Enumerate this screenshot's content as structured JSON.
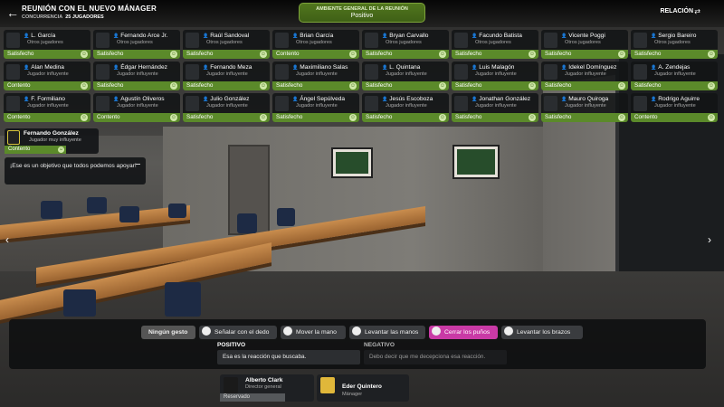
{
  "header": {
    "title": "REUNIÓN CON EL NUEVO MÁNAGER",
    "attendance_label": "CONCURRENCIA",
    "attendance_value": "25 JUGADORES",
    "mood_label": "AMBIENTE GENERAL DE LA REUNIÓN",
    "mood_value": "Positivo",
    "relation_label": "RELACIÓN"
  },
  "players": [
    {
      "name": "L. García",
      "role": "Otros jugadores",
      "status": "Satisfecho"
    },
    {
      "name": "Fernando Arce Jr.",
      "role": "Otros jugadores",
      "status": "Satisfecho"
    },
    {
      "name": "Raúl Sandoval",
      "role": "Otros jugadores",
      "status": "Satisfecho"
    },
    {
      "name": "Brian García",
      "role": "Otros jugadores",
      "status": "Contento"
    },
    {
      "name": "Bryan Carvallo",
      "role": "Otros jugadores",
      "status": "Satisfecho"
    },
    {
      "name": "Facundo Batista",
      "role": "Otros jugadores",
      "status": "Satisfecho"
    },
    {
      "name": "Vicente Poggi",
      "role": "Otros jugadores",
      "status": "Satisfecho"
    },
    {
      "name": "Sergio Bareiro",
      "role": "Otros jugadores",
      "status": "Satisfecho"
    },
    {
      "name": "Alan Medina",
      "role": "Jugador influyente",
      "status": "Contento"
    },
    {
      "name": "Édgar Hernández",
      "role": "Jugador influyente",
      "status": "Satisfecho"
    },
    {
      "name": "Fernando Meza",
      "role": "Jugador influyente",
      "status": "Satisfecho"
    },
    {
      "name": "Maximiliano Salas",
      "role": "Jugador influyente",
      "status": "Satisfecho"
    },
    {
      "name": "L. Quintana",
      "role": "Jugador influyente",
      "status": "Satisfecho"
    },
    {
      "name": "Luis Malagón",
      "role": "Jugador influyente",
      "status": "Satisfecho"
    },
    {
      "name": "Idekel Domínguez",
      "role": "Jugador influyente",
      "status": "Satisfecho"
    },
    {
      "name": "A. Zendejas",
      "role": "Jugador influyente",
      "status": "Satisfecho"
    },
    {
      "name": "F. Formiliano",
      "role": "Jugador influyente",
      "status": "Contento"
    },
    {
      "name": "Agustín Oliveros",
      "role": "Jugador influyente",
      "status": "Contento"
    },
    {
      "name": "Julio González",
      "role": "Jugador influyente",
      "status": "Satisfecho"
    },
    {
      "name": "Ángel Sepúlveda",
      "role": "Jugador influyente",
      "status": "Satisfecho"
    },
    {
      "name": "Jesús Escoboza",
      "role": "Jugador influyente",
      "status": "Satisfecho"
    },
    {
      "name": "Jonathan González",
      "role": "Jugador influyente",
      "status": "Satisfecho"
    },
    {
      "name": "Mauro Quiroga",
      "role": "Jugador influyente",
      "status": "Satisfecho"
    },
    {
      "name": "Rodrigo Aguirre",
      "role": "Jugador influyente",
      "status": "Contento"
    }
  ],
  "speaker": {
    "name": "Fernando González",
    "role": "Jugador muy influyente",
    "status": "Contento",
    "quote": "¡Ese es un objetivo que todos podemos apoyar!"
  },
  "gestures": {
    "none": "Ningún gesto",
    "items": [
      "Señalar con el dedo",
      "Mover la mano",
      "Levantar las manos",
      "Cerrar los puños",
      "Levantar los brazos"
    ]
  },
  "responses": {
    "positive_title": "POSITIVO",
    "positive_text": "Esa es la reacción que buscaba.",
    "negative_title": "NEGATIVO",
    "negative_text": "Debo decir que me decepciona esa reacción."
  },
  "staff": [
    {
      "name": "Alberto Clark",
      "role": "Director general",
      "status": "Reservado"
    },
    {
      "name": "Eder Quintero",
      "role": "Mánager"
    }
  ],
  "colors": {
    "accent_green": "#5b8a2a",
    "active_gesture": "#c93aa6"
  }
}
